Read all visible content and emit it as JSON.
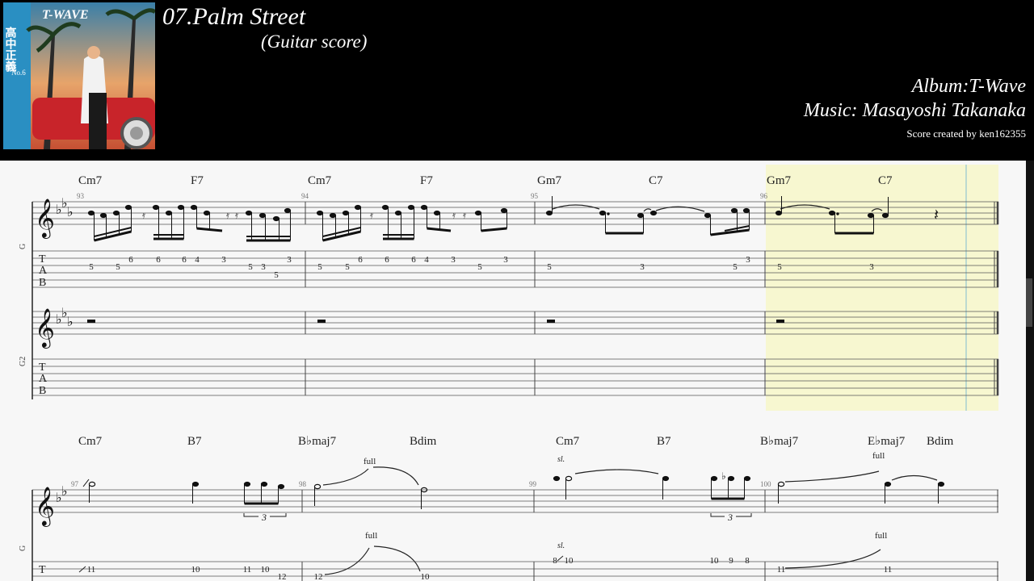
{
  "header": {
    "title": "07.Palm Street",
    "subtitle": "(Guitar score)",
    "album": "Album:T-Wave",
    "music": "Music: Masayoshi Takanaka",
    "credit": "Score created by ken162355"
  },
  "cover": {
    "brand": "T-WAVE",
    "artist": "高中正義",
    "number": "No.6"
  },
  "system1": {
    "track1_label": "G",
    "track2_label": "G2",
    "chords": [
      "Cm7",
      "F7",
      "Cm7",
      "F7",
      "Gm7",
      "C7",
      "Gm7",
      "C7"
    ],
    "measures": [
      "93",
      "94",
      "95",
      "96"
    ],
    "tab_numbers": {
      "m93": [
        "5",
        "5",
        "6",
        "6",
        "6",
        "4",
        "3",
        "5",
        "3",
        "5",
        "3"
      ],
      "m94": [
        "5",
        "5",
        "6",
        "6",
        "6",
        "4",
        "3",
        "5",
        "3"
      ],
      "m95": [
        "5",
        "3",
        "5",
        "3"
      ],
      "m96": [
        "5",
        "3"
      ]
    }
  },
  "system2": {
    "track1_label": "G",
    "chords": [
      "Cm7",
      "B7",
      "B♭maj7",
      "Bdim",
      "Cm7",
      "B7",
      "B♭maj7",
      "E♭maj7",
      "Bdim"
    ],
    "measures": [
      "97",
      "98",
      "99",
      "100"
    ],
    "annotations": {
      "full": "full",
      "slide": "sl.",
      "triplet": "3"
    },
    "tab_numbers": {
      "m97": [
        "11",
        "10",
        "11",
        "10",
        "12"
      ],
      "m98": [
        "12",
        "10"
      ],
      "m99": [
        "8",
        "10",
        "10",
        "9",
        "8"
      ],
      "m100": [
        "11",
        "11"
      ]
    }
  },
  "colors": {
    "background": "#000000",
    "score_bg": "#f7f7f7",
    "highlight": "#f7f7d0",
    "cursor": "#a8d0d0"
  }
}
